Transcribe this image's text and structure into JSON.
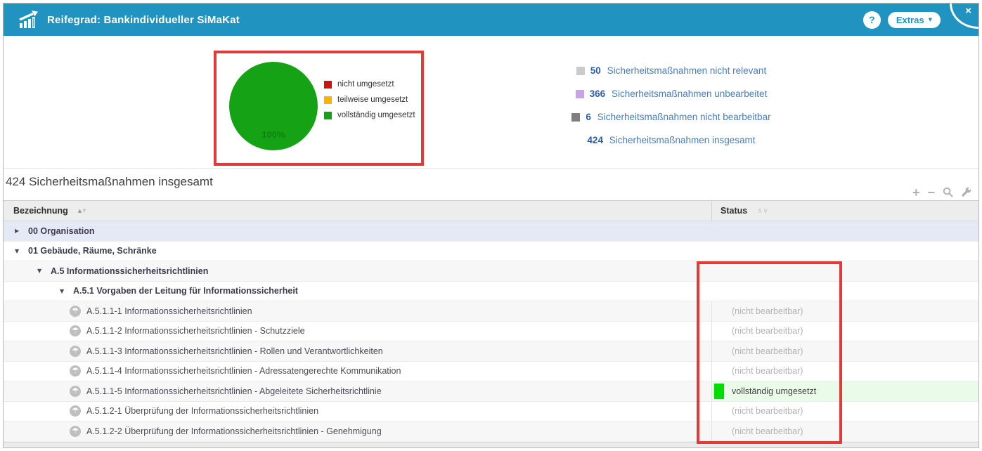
{
  "titlebar": {
    "title": "Reifegrad: Bankindividueller SiMaKat",
    "help_label": "?",
    "extras_label": "Extras",
    "close_label": "×"
  },
  "chart_data": {
    "type": "pie",
    "slices": [
      {
        "label": "nicht umgesetzt",
        "value": 0,
        "color": "#cc1212"
      },
      {
        "label": "teilweise umgesetzt",
        "value": 0,
        "color": "#ffb200"
      },
      {
        "label": "vollständig umgesetzt",
        "value": 100,
        "color": "#15a315"
      }
    ],
    "data_label": "100%",
    "legend_position": "right"
  },
  "summary_links": [
    {
      "count": "50",
      "label": "Sicherheitsmaßnahmen nicht relevant",
      "bullet_color": "#cbcbcb"
    },
    {
      "count": "366",
      "label": "Sicherheitsmaßnahmen unbearbeitet",
      "bullet_color": "#c7a4e6"
    },
    {
      "count": "6",
      "label": "Sicherheitsmaßnahmen nicht bearbeitbar",
      "bullet_color": "#7f7f7f"
    },
    {
      "count": "424",
      "label": "Sicherheitsmaßnahmen insgesamt",
      "bullet_color": null
    }
  ],
  "section": {
    "title": "424 Sicherheitsmaßnahmen insgesamt"
  },
  "toolbar": {
    "icons": [
      "plus-icon",
      "minus-icon",
      "search-icon",
      "wrench-icon"
    ]
  },
  "table": {
    "columns": [
      {
        "label": "Bezeichnung",
        "sort_style": "triangles"
      },
      {
        "label": "Status",
        "sort_style": "chevrons"
      }
    ],
    "rows": [
      {
        "kind": "group",
        "level": 0,
        "expanded": false,
        "selected": true,
        "label": "00 Organisation"
      },
      {
        "kind": "group",
        "level": 0,
        "expanded": true,
        "label": "01 Gebäude, Räume, Schränke"
      },
      {
        "kind": "group",
        "level": 1,
        "expanded": true,
        "label": "A.5 Informationssicherheitsrichtlinien"
      },
      {
        "kind": "group",
        "level": 2,
        "expanded": true,
        "label": "A.5.1 Vorgaben der Leitung für Informationssicherheit"
      },
      {
        "kind": "leaf",
        "level": 3,
        "label": "A.5.1.1-1 Informationssicherheitsrichtlinien",
        "status": "(nicht bearbeitbar)",
        "status_kind": "disabled"
      },
      {
        "kind": "leaf",
        "level": 3,
        "label": "A.5.1.1-2 Informationssicherheitsrichtlinien - Schutzziele",
        "status": "(nicht bearbeitbar)",
        "status_kind": "disabled"
      },
      {
        "kind": "leaf",
        "level": 3,
        "label": "A.5.1.1-3 Informationssicherheitsrichtlinien - Rollen und Verantwortlichkeiten",
        "status": "(nicht bearbeitbar)",
        "status_kind": "disabled"
      },
      {
        "kind": "leaf",
        "level": 3,
        "label": "A.5.1.1-4 Informationssicherheitsrichtlinien - Adressatengerechte Kommunikation",
        "status": "(nicht bearbeitbar)",
        "status_kind": "disabled"
      },
      {
        "kind": "leaf",
        "level": 3,
        "label": "A.5.1.1-5 Informationssicherheitsrichtlinien - Abgeleitete Sicherheitsrichtlinie",
        "status": "vollständig umgesetzt",
        "status_kind": "complete"
      },
      {
        "kind": "leaf",
        "level": 3,
        "label": "A.5.1.2-1 Überprüfung der Informationssicherheitsrichtlinien",
        "status": "(nicht bearbeitbar)",
        "status_kind": "disabled"
      },
      {
        "kind": "leaf",
        "level": 3,
        "label": "A.5.1.2-2 Überprüfung der Informationssicherheitsrichtlinien - Genehmigung",
        "status": "(nicht bearbeitbar)",
        "status_kind": "disabled"
      }
    ]
  },
  "status_styles": {
    "complete": {
      "square_color": "#00dd00",
      "bg": "#eafbea"
    }
  },
  "annotations": {
    "highlight_color": "#e23a3a"
  }
}
